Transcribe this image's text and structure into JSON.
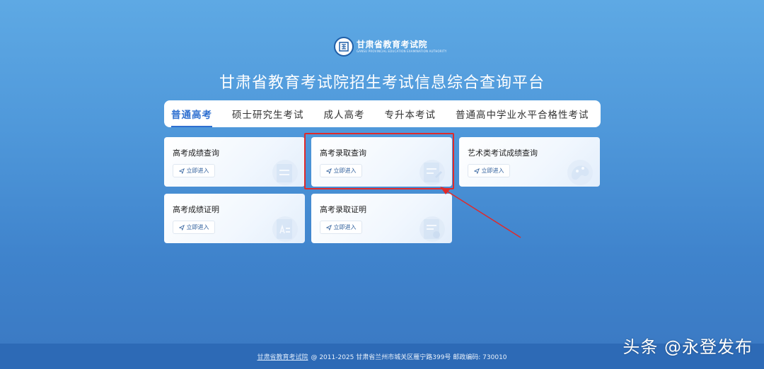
{
  "header": {
    "logo_name": "甘肃省教育考试院",
    "logo_sub": "GANSU PROVINCIAL EDUCATION EXAMINATION AUTHORITY",
    "title": "甘肃省教育考试院招生考试信息综合查询平台"
  },
  "tabs": [
    {
      "label": "普通高考",
      "active": true
    },
    {
      "label": "硕士研究生考试"
    },
    {
      "label": "成人高考"
    },
    {
      "label": "专升本考试"
    },
    {
      "label": "普通高中学业水平合格性考试"
    }
  ],
  "cards": [
    {
      "title": "高考成绩查询",
      "button": "立即进入"
    },
    {
      "title": "高考录取查询",
      "button": "立即进入"
    },
    {
      "title": "艺术类考试成绩查询",
      "button": "立即进入"
    },
    {
      "title": "高考成绩证明",
      "button": "立即进入"
    },
    {
      "title": "高考录取证明",
      "button": "立即进入"
    }
  ],
  "footer": {
    "link": "甘肃省教育考试院",
    "text": "@ 2011-2025 甘肃省兰州市城关区雁宁路399号 邮政编码: 730010"
  },
  "watermark": "头条 @永登发布",
  "colors": {
    "accent": "#2e6fd0",
    "highlight": "#e02a2a",
    "footer_bg": "#2d6ab6"
  }
}
